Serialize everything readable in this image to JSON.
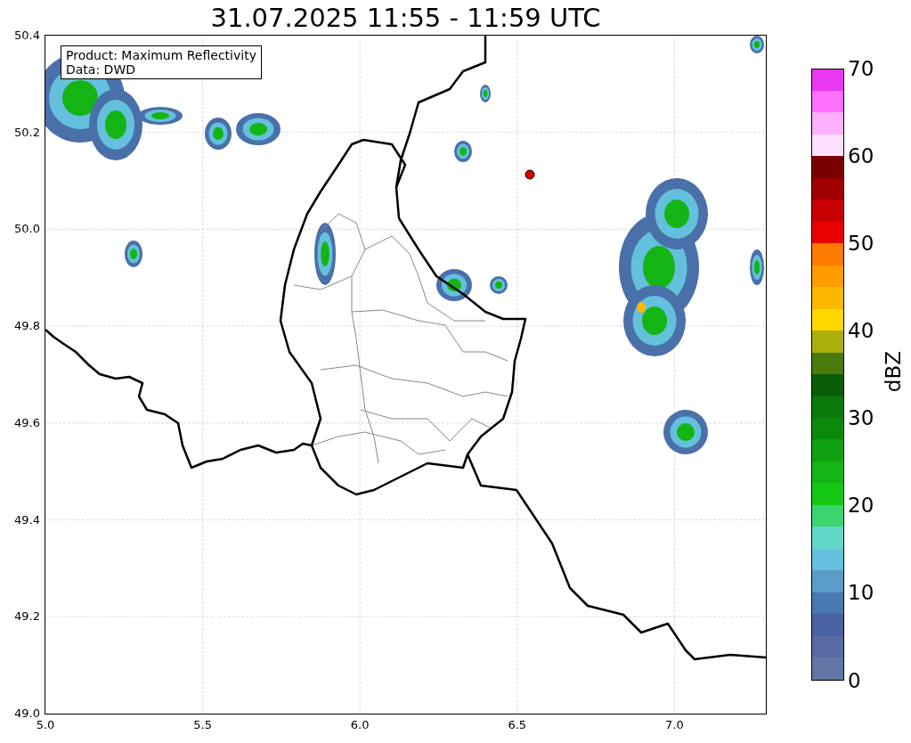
{
  "title": "31.07.2025 11:55 - 11:59 UTC",
  "map": {
    "legend": [
      "Product: Maximum Reflectivity",
      "Data: DWD"
    ],
    "x_ticks": [
      "5.0",
      "5.5",
      "6.0",
      "6.5",
      "7.0"
    ],
    "y_ticks": [
      "50.4",
      "50.2",
      "50.0",
      "49.8",
      "49.6",
      "49.4",
      "49.2",
      "49.0"
    ]
  },
  "colorbar": {
    "label": "dBZ",
    "ticks": [
      "70",
      "60",
      "50",
      "40",
      "30",
      "20",
      "10",
      "0"
    ],
    "bands": [
      {
        "color": "#e838f0"
      },
      {
        "color": "#ff70ff"
      },
      {
        "color": "#ffb0ff"
      },
      {
        "color": "#ffe0ff"
      },
      {
        "color": "#7a0000"
      },
      {
        "color": "#a00000"
      },
      {
        "color": "#c80000"
      },
      {
        "color": "#e80000"
      },
      {
        "color": "#ff7a00"
      },
      {
        "color": "#ff9c00"
      },
      {
        "color": "#ffb800"
      },
      {
        "color": "#ffd800"
      },
      {
        "color": "#aab00a"
      },
      {
        "color": "#4a7a0a"
      },
      {
        "color": "#0a5e0a"
      },
      {
        "color": "#0a780a"
      },
      {
        "color": "#0a8a0a"
      },
      {
        "color": "#0ea00e"
      },
      {
        "color": "#14b414"
      },
      {
        "color": "#14c814"
      },
      {
        "color": "#3cd470"
      },
      {
        "color": "#64d8c8"
      },
      {
        "color": "#64c0dc"
      },
      {
        "color": "#5a9cc8"
      },
      {
        "color": "#4a78b0"
      },
      {
        "color": "#4a62a4"
      },
      {
        "color": "#5a6aa2"
      },
      {
        "color": "#6476a6"
      }
    ]
  }
}
